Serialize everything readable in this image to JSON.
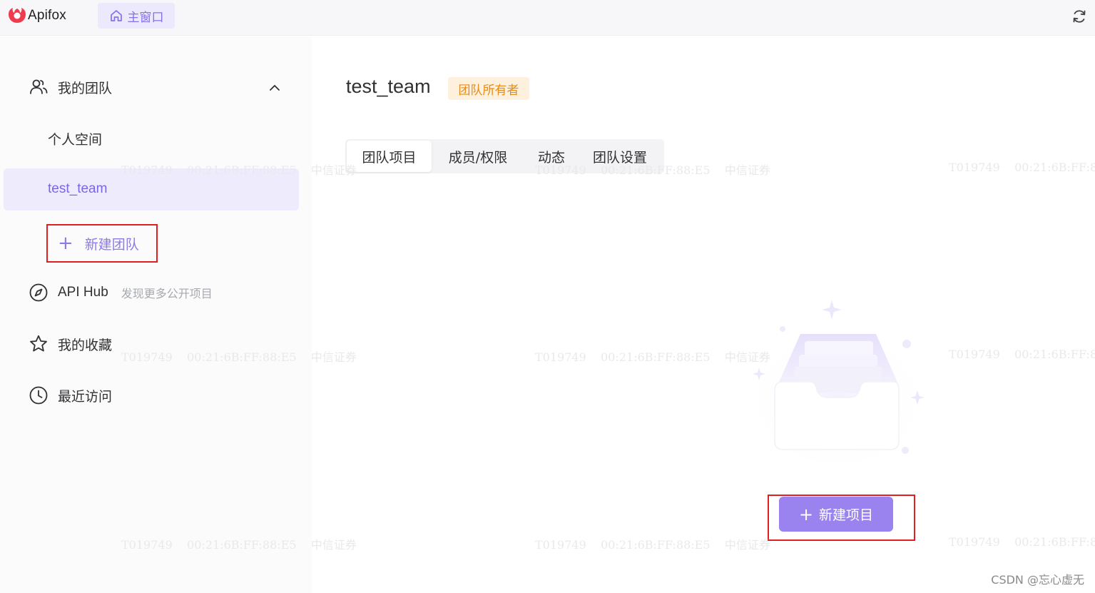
{
  "app": {
    "logo_text": "Apifox",
    "home_tab_label": "主窗口",
    "icons": {
      "logo": "apifox-logo-icon",
      "home": "home-icon",
      "refresh": "refresh-icon"
    }
  },
  "sidebar": {
    "my_teams_label": "我的团队",
    "personal_space_label": "个人空间",
    "selected_team_label": "test_team",
    "new_team_label": "新建团队",
    "api_hub_label": "API Hub",
    "api_hub_subtitle": "发现更多公开项目",
    "favorites_label": "我的收藏",
    "recent_label": "最近访问"
  },
  "main": {
    "team_name": "test_team",
    "role_badge": "团队所有者",
    "tabs": [
      {
        "label": "团队项目",
        "active": true
      },
      {
        "label": "成员/权限",
        "active": false
      },
      {
        "label": "动态",
        "active": false
      },
      {
        "label": "团队设置",
        "active": false
      }
    ],
    "new_project_label": "新建项目"
  },
  "watermark": {
    "id_text": "T019749",
    "mac_text": "00:21:6B:FF:88:E5",
    "org_text": "中信证券"
  },
  "credit": "CSDN @忘心虚无",
  "colors": {
    "accent": "#9a83ef",
    "accent_text": "#7b66e3",
    "badge_bg": "#fdf0dd",
    "badge_text": "#e58c1a",
    "highlight_border": "#e02020"
  }
}
